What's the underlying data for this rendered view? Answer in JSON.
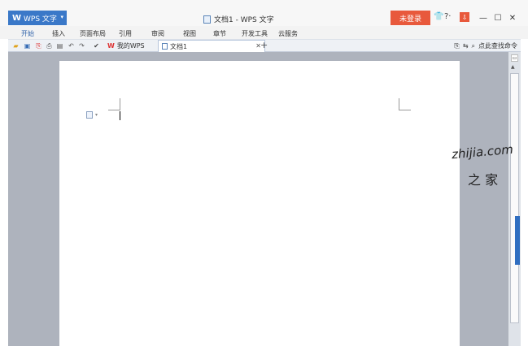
{
  "titlebar": {
    "app_name": "WPS 文字",
    "title": "文档1 - WPS 文字",
    "login_label": "未登录",
    "help_label": "?·"
  },
  "ribbon": {
    "tabs": [
      "开始",
      "插入",
      "页面布局",
      "引用",
      "审阅",
      "视图",
      "章节",
      "开发工具",
      "云服务"
    ]
  },
  "doc_tabs": {
    "mywps_label": "我的WPS",
    "doc1_label": "文档1",
    "search_label": "点此查找命令"
  },
  "watermark": {
    "line1": "zhijia.com",
    "line2": "之 家"
  },
  "colors": {
    "accent": "#3a78c8",
    "login": "#e8593c",
    "workspace": "#aeb3bd"
  }
}
